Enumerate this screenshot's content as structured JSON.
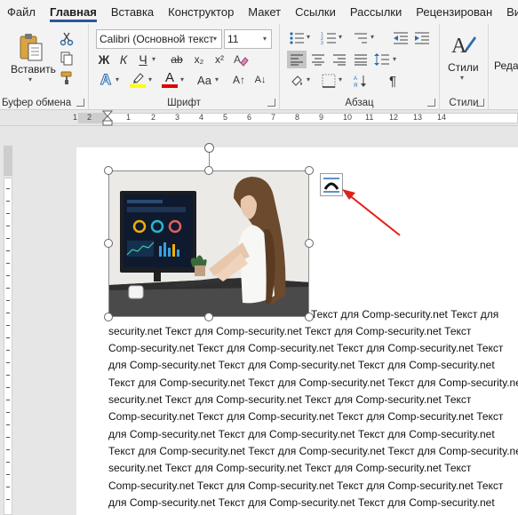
{
  "menu": {
    "tabs": [
      "Файл",
      "Главная",
      "Вставка",
      "Конструктор",
      "Макет",
      "Ссылки",
      "Рассылки",
      "Рецензирован",
      "Вид"
    ],
    "active_index": 1
  },
  "ribbon": {
    "clipboard": {
      "paste_label": "Вставить",
      "group_label": "Буфер обмена"
    },
    "font": {
      "font_name": "Calibri (Основной текст",
      "font_size": "11",
      "bold": "Ж",
      "italic": "К",
      "underline": "Ч",
      "strike": "ab",
      "subscript": "x₂",
      "superscript": "x²",
      "change_case": "Aa",
      "grow": "A↑",
      "shrink": "A↓",
      "group_label": "Шрифт",
      "highlight_color": "#ffff00",
      "font_color": "#e00000"
    },
    "paragraph": {
      "group_label": "Абзац",
      "pilcrow": "¶"
    },
    "styles": {
      "styles_label": "Стили",
      "group_label": "Стили",
      "editing_label": "Реда"
    }
  },
  "ruler": {
    "numbers": [
      "1",
      "2",
      "1",
      "1",
      "2",
      "3",
      "4",
      "5",
      "6",
      "7",
      "8",
      "9",
      "10",
      "11",
      "12",
      "13",
      "14"
    ]
  },
  "document": {
    "lines": [
      "Текст для Comp-security.net Текст для",
      "security.net Текст для Comp-security.net Текст для Comp-security.net Текст",
      "Comp-security.net Текст для Comp-security.net Текст для Comp-security.net Текст",
      "для Comp-security.net Текст для Comp-security.net Текст для Comp-security.net",
      "Текст для Comp-security.net Текст для Comp-security.net Текст для Comp-security.net",
      "security.net Текст для Comp-security.net Текст для Comp-security.net Текст",
      "Comp-security.net Текст для Comp-security.net Текст для Comp-security.net Текст",
      "для Comp-security.net Текст для Comp-security.net Текст для Comp-security.net",
      "Текст для Comp-security.net Текст для Comp-security.net Текст для Comp-security.net",
      "security.net Текст для Comp-security.net Текст для Comp-security.net Текст",
      "Comp-security.net Текст для Comp-security.net Текст для Comp-security.net Текст",
      "для Comp-security.net Текст для Comp-security.net Текст для Comp-security.net"
    ]
  },
  "colors": {
    "accent": "#2b579a",
    "arrow": "#e0201b"
  }
}
